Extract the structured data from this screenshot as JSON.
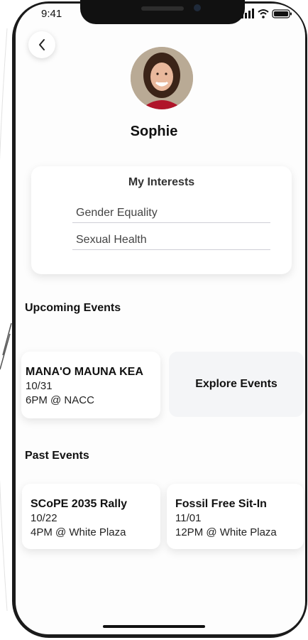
{
  "status_bar": {
    "time": "9:41"
  },
  "profile": {
    "name": "Sophie"
  },
  "interests": {
    "title": "My Interests",
    "items": [
      "Gender Equality",
      "Sexual Health"
    ]
  },
  "upcoming": {
    "title": "Upcoming Events",
    "events": [
      {
        "title": "MANA'O MAUNA KEA",
        "date": "10/31",
        "time": "6PM @ NACC"
      }
    ],
    "explore_label": "Explore Events"
  },
  "past": {
    "title": "Past Events",
    "events": [
      {
        "title": "SCoPE 2035 Rally",
        "date": "10/22",
        "time": "4PM @ White Plaza"
      },
      {
        "title": "Fossil Free Sit-In",
        "date": "11/01",
        "time": "12PM @ White Plaza"
      }
    ]
  },
  "colors": {
    "card_bg": "#ffffff",
    "explore_bg": "#f4f5f7",
    "text": "#111111"
  }
}
